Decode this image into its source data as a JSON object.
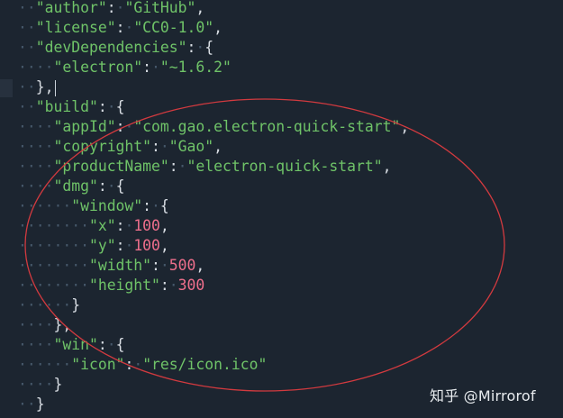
{
  "editor": {
    "language": "json",
    "lines": [
      [
        {
          "t": "ws",
          "v": "··"
        },
        {
          "t": "key",
          "v": "\"author\""
        },
        {
          "t": "punc",
          "v": ":"
        },
        {
          "t": "ws",
          "v": "·"
        },
        {
          "t": "str",
          "v": "\"GitHub\""
        },
        {
          "t": "punc",
          "v": ","
        }
      ],
      [
        {
          "t": "ws",
          "v": "··"
        },
        {
          "t": "key",
          "v": "\"license\""
        },
        {
          "t": "punc",
          "v": ":"
        },
        {
          "t": "ws",
          "v": "·"
        },
        {
          "t": "str",
          "v": "\"CC0-1.0\""
        },
        {
          "t": "punc",
          "v": ","
        }
      ],
      [
        {
          "t": "ws",
          "v": "··"
        },
        {
          "t": "key",
          "v": "\"devDependencies\""
        },
        {
          "t": "punc",
          "v": ":"
        },
        {
          "t": "ws",
          "v": "·"
        },
        {
          "t": "punc",
          "v": "{"
        }
      ],
      [
        {
          "t": "ws",
          "v": "····"
        },
        {
          "t": "key",
          "v": "\"electron\""
        },
        {
          "t": "punc",
          "v": ":"
        },
        {
          "t": "ws",
          "v": "·"
        },
        {
          "t": "str",
          "v": "\"~1.6.2\""
        }
      ],
      [
        {
          "t": "ws",
          "v": "··"
        },
        {
          "t": "punc",
          "v": "},"
        },
        {
          "t": "cursor",
          "v": ""
        }
      ],
      [
        {
          "t": "ws",
          "v": "··"
        },
        {
          "t": "key",
          "v": "\"build\""
        },
        {
          "t": "punc",
          "v": ":"
        },
        {
          "t": "ws",
          "v": "·"
        },
        {
          "t": "punc",
          "v": "{"
        }
      ],
      [
        {
          "t": "ws",
          "v": "····"
        },
        {
          "t": "key",
          "v": "\"appId\""
        },
        {
          "t": "punc",
          "v": ":"
        },
        {
          "t": "ws",
          "v": "·"
        },
        {
          "t": "str",
          "v": "\"com.gao.electron-quick-start\""
        },
        {
          "t": "punc",
          "v": ","
        }
      ],
      [
        {
          "t": "ws",
          "v": "····"
        },
        {
          "t": "key",
          "v": "\"copyright\""
        },
        {
          "t": "punc",
          "v": ":"
        },
        {
          "t": "ws",
          "v": "·"
        },
        {
          "t": "str",
          "v": "\"Gao\""
        },
        {
          "t": "punc",
          "v": ","
        }
      ],
      [
        {
          "t": "ws",
          "v": "····"
        },
        {
          "t": "key",
          "v": "\"productName\""
        },
        {
          "t": "punc",
          "v": ":"
        },
        {
          "t": "ws",
          "v": "·"
        },
        {
          "t": "str",
          "v": "\"electron-quick-start\""
        },
        {
          "t": "punc",
          "v": ","
        }
      ],
      [
        {
          "t": "ws",
          "v": "····"
        },
        {
          "t": "key",
          "v": "\"dmg\""
        },
        {
          "t": "punc",
          "v": ":"
        },
        {
          "t": "ws",
          "v": "·"
        },
        {
          "t": "punc",
          "v": "{"
        }
      ],
      [
        {
          "t": "ws",
          "v": "······"
        },
        {
          "t": "key",
          "v": "\"window\""
        },
        {
          "t": "punc",
          "v": ":"
        },
        {
          "t": "ws",
          "v": "·"
        },
        {
          "t": "punc",
          "v": "{"
        }
      ],
      [
        {
          "t": "ws",
          "v": "········"
        },
        {
          "t": "key",
          "v": "\"x\""
        },
        {
          "t": "punc",
          "v": ":"
        },
        {
          "t": "ws",
          "v": "·"
        },
        {
          "t": "num",
          "v": "100"
        },
        {
          "t": "punc",
          "v": ","
        }
      ],
      [
        {
          "t": "ws",
          "v": "········"
        },
        {
          "t": "key",
          "v": "\"y\""
        },
        {
          "t": "punc",
          "v": ":"
        },
        {
          "t": "ws",
          "v": "·"
        },
        {
          "t": "num",
          "v": "100"
        },
        {
          "t": "punc",
          "v": ","
        }
      ],
      [
        {
          "t": "ws",
          "v": "········"
        },
        {
          "t": "key",
          "v": "\"width\""
        },
        {
          "t": "punc",
          "v": ":"
        },
        {
          "t": "ws",
          "v": "·"
        },
        {
          "t": "num",
          "v": "500"
        },
        {
          "t": "punc",
          "v": ","
        }
      ],
      [
        {
          "t": "ws",
          "v": "········"
        },
        {
          "t": "key",
          "v": "\"height\""
        },
        {
          "t": "punc",
          "v": ":"
        },
        {
          "t": "ws",
          "v": "·"
        },
        {
          "t": "num",
          "v": "300"
        }
      ],
      [
        {
          "t": "ws",
          "v": "······"
        },
        {
          "t": "punc",
          "v": "}"
        }
      ],
      [
        {
          "t": "ws",
          "v": "····"
        },
        {
          "t": "punc",
          "v": "},"
        }
      ],
      [
        {
          "t": "ws",
          "v": "····"
        },
        {
          "t": "key",
          "v": "\"win\""
        },
        {
          "t": "punc",
          "v": ":"
        },
        {
          "t": "ws",
          "v": "·"
        },
        {
          "t": "punc",
          "v": "{"
        }
      ],
      [
        {
          "t": "ws",
          "v": "······"
        },
        {
          "t": "key",
          "v": "\"icon\""
        },
        {
          "t": "punc",
          "v": ":"
        },
        {
          "t": "ws",
          "v": "·"
        },
        {
          "t": "str",
          "v": "\"res/icon.ico\""
        }
      ],
      [
        {
          "t": "ws",
          "v": "····"
        },
        {
          "t": "punc",
          "v": "}"
        }
      ],
      [
        {
          "t": "ws",
          "v": "··"
        },
        {
          "t": "punc",
          "v": "}"
        }
      ]
    ],
    "cursor_line": 5,
    "colors": {
      "background": "#1c2530",
      "key": "#6fc368",
      "string": "#6fc368",
      "number": "#ef6f8c",
      "punctuation": "#d8dde3",
      "whitespace": "#46586a",
      "annotation": "#d23a3f"
    }
  },
  "annotation": {
    "shape": "ellipse",
    "color": "#d23a3f"
  },
  "watermark": {
    "text": "知乎 @Mirrorof"
  }
}
